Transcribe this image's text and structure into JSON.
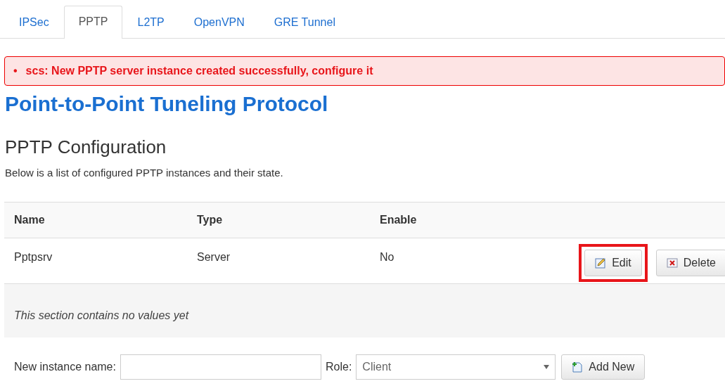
{
  "tabs": [
    {
      "label": "IPSec",
      "selected": false
    },
    {
      "label": "PPTP",
      "selected": true
    },
    {
      "label": "L2TP",
      "selected": false
    },
    {
      "label": "OpenVPN",
      "selected": false
    },
    {
      "label": "GRE Tunnel",
      "selected": false
    }
  ],
  "alert": {
    "bullet": "•",
    "message": "scs: New PPTP server instance created successfully, configure it"
  },
  "page_title": "Point-to-Point Tuneling Protocol",
  "section": {
    "title": "PPTP Configuration",
    "description": "Below is a list of configured PPTP instances and their state."
  },
  "table": {
    "columns": [
      "Name",
      "Type",
      "Enable"
    ],
    "rows": [
      {
        "cells": [
          "Pptpsrv",
          "Server",
          "No"
        ],
        "actions": [
          {
            "kind": "edit",
            "label": "Edit",
            "highlighted": true
          },
          {
            "kind": "delete",
            "label": "Delete",
            "highlighted": false
          }
        ]
      }
    ],
    "empty_note": "This section contains no values yet"
  },
  "add_form": {
    "name_label": "New instance name:",
    "role_label": "Role:",
    "role_value": "Client",
    "button": "Add New"
  }
}
